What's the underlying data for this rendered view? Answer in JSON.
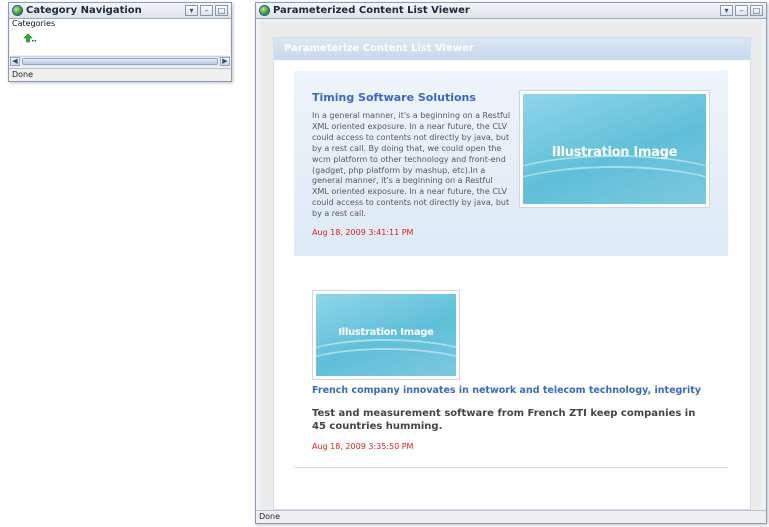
{
  "category_window": {
    "title": "Category Navigation",
    "label": "Categories",
    "status": "Done"
  },
  "main_window": {
    "title": "Parameterized Content List Viewer",
    "status": "Done"
  },
  "clv": {
    "header": "Parameterize Content List Viewer",
    "items": [
      {
        "title": "Timing Software Solutions",
        "body": "In a general manner, it's a beginning on a Restful XML oriented exposure. In a near future, the CLV could access to contents not directly by java, but by a rest call. By doing that, we could open the wcm platform to other technology and front-end (gadget, php platform by mashup, etc).In a general manner, it's a beginning on a Restful XML oriented exposure. In a near future, the CLV could access to contents not directly by java, but by a rest call.",
        "date": "Aug 18, 2009 3:41:11 PM",
        "image_text": "Illustration Image"
      },
      {
        "title": "French company innovates in network and telecom technology, integrity",
        "description": "Test and measurement software  from French ZTI keep companies in 45 countries humming.",
        "date": "Aug 18, 2009 3:35:50 PM",
        "image_text": "Illustration Image"
      }
    ]
  },
  "window_buttons": {
    "dropdown": "▾",
    "minimize": "–",
    "maximize": "□"
  },
  "colors": {
    "link_title": "#3b68c0",
    "date": "#e02020",
    "header_bg": "#c7d8ec"
  }
}
